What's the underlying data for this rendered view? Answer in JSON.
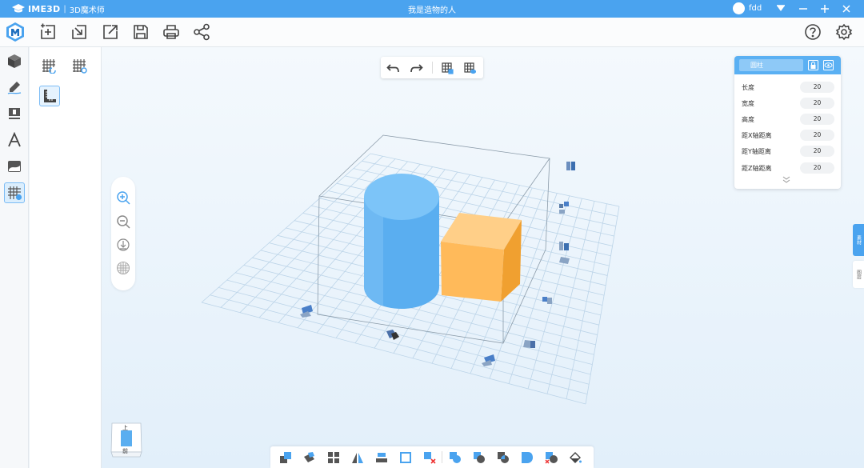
{
  "titlebar": {
    "brand": "IME3D",
    "app_name": "3D魔术师",
    "document_title": "我是造物的人",
    "user_name": "fdd",
    "bg_color": "#4aa3ef",
    "icons": [
      "graduation-cap-icon",
      "dropdown-icon",
      "minimize-icon",
      "maximize-icon",
      "close-icon"
    ]
  },
  "toolbar": {
    "icons": [
      "app-logo-icon",
      "new-file-icon",
      "import-icon",
      "export-icon",
      "save-icon",
      "print-icon",
      "share-icon",
      "help-icon",
      "settings-icon"
    ]
  },
  "left_tools": [
    "cube-icon",
    "pen-icon",
    "stamp-icon",
    "text-icon",
    "image-icon",
    "grid-settings-icon"
  ],
  "sub_tools": [
    "grid-rotate-icon",
    "grid-refresh-icon",
    "ruler-corner-icon"
  ],
  "undo_bar": {
    "icons": [
      "undo-icon",
      "redo-icon",
      "grid-snap-icon",
      "grid-view-icon"
    ]
  },
  "zoom_bar": {
    "icons": [
      "zoom-in-icon",
      "zoom-out-icon",
      "fit-view-icon",
      "grid-toggle-icon"
    ]
  },
  "view_cube": {
    "top_label": "上",
    "front_label": "前"
  },
  "bottom_bar": {
    "icons": [
      "arrange-icon",
      "rotate-object-icon",
      "array-icon",
      "mirror-icon",
      "align-icon",
      "frame-icon",
      "delete-align-icon",
      "union-icon",
      "subtract-icon",
      "intersect-icon",
      "shape-icon",
      "delete-shape-icon",
      "paint-bucket-icon"
    ]
  },
  "properties": {
    "object_name": "圆柱",
    "fields": [
      {
        "label": "长度",
        "value": "20"
      },
      {
        "label": "宽度",
        "value": "20"
      },
      {
        "label": "高度",
        "value": "20"
      },
      {
        "label": "距X轴距离",
        "value": "20"
      },
      {
        "label": "距Y轴距离",
        "value": "20"
      },
      {
        "label": "距Z轴距离",
        "value": "20"
      }
    ],
    "header_color": "#5ab0f3"
  },
  "side_tabs": [
    {
      "label": "素材"
    },
    {
      "label": "图层"
    }
  ],
  "scene": {
    "cylinder_color": "#5aaef0",
    "cube_color": "#ffb44a",
    "grid_color": "#b8d3ea"
  }
}
